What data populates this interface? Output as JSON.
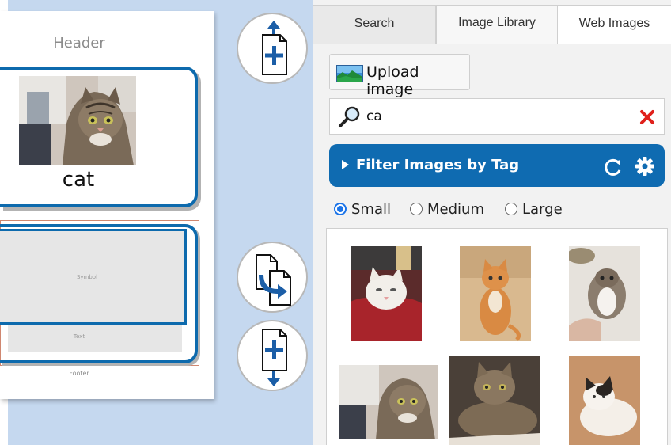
{
  "canvas": {
    "header_text": "Header",
    "card1_word": "cat",
    "symbol_placeholder": "Symbol",
    "text_placeholder": "Text",
    "footer_text": "Footer"
  },
  "tabs": [
    {
      "label": "Search"
    },
    {
      "label": "Image Library"
    },
    {
      "label": "Web Images"
    }
  ],
  "upload": {
    "label": "Upload image"
  },
  "search": {
    "value": "ca",
    "placeholder": ""
  },
  "filter": {
    "label": "Filter Images by Tag"
  },
  "sizes": [
    {
      "label": "Small",
      "checked": true
    },
    {
      "label": "Medium",
      "checked": false
    },
    {
      "label": "Large",
      "checked": false
    }
  ],
  "colors": {
    "accent": "#0f6bb1",
    "panel_bg": "#f2f2f2",
    "canvas_bg": "#c5d8ef",
    "clear": "#e0201b"
  },
  "icons": [
    "add-page-above-icon",
    "duplicate-page-icon",
    "add-page-below-icon",
    "landscape-image-icon",
    "magnifier-icon",
    "clear-x-icon",
    "refresh-icon",
    "gear-icon"
  ]
}
